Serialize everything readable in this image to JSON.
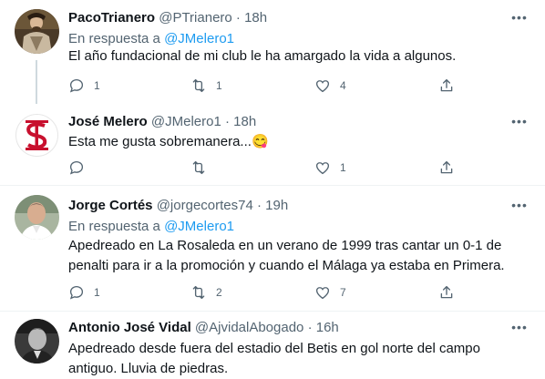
{
  "tweets": [
    {
      "name": "PacoTrianero",
      "handle": "@PTrianero",
      "time": "18h",
      "reply_prefix": "En respuesta a",
      "reply_handle": "@JMelero1",
      "text": "El año fundacional de mi club le ha amargado la vida a algunos.",
      "replies": "1",
      "retweets": "1",
      "likes": "4"
    },
    {
      "name": "José Melero",
      "handle": "@JMelero1",
      "time": "18h",
      "text": "Esta me gusta sobremanera...",
      "emoji": "😋",
      "replies": "",
      "retweets": "",
      "likes": "1"
    },
    {
      "name": "Jorge Cortés",
      "handle": "@jorgecortes74",
      "time": "19h",
      "reply_prefix": "En respuesta a",
      "reply_handle": "@JMelero1",
      "text_line1": "Apedreado en La Rosaleda en un verano de 1999 tras cantar un 0-1 de",
      "text_line2": "penalti para ir a la promoción y cuando el Málaga ya estaba en Primera.",
      "replies": "1",
      "retweets": "2",
      "likes": "7"
    },
    {
      "name": "Antonio José Vidal",
      "handle": "@AjvidalAbogado",
      "time": "16h",
      "text_line1": "Apedreado desde fuera del estadio del Betis en gol norte del campo",
      "text_line2": "antiguo. Lluvia de piedras."
    }
  ],
  "separator": "·",
  "more_icon": "•••",
  "colors": {
    "accent": "#1d9bf0",
    "secondary": "#536471",
    "text": "#0f1419",
    "thread_line": "#cfd9de",
    "logo_red": "#c8102e"
  }
}
